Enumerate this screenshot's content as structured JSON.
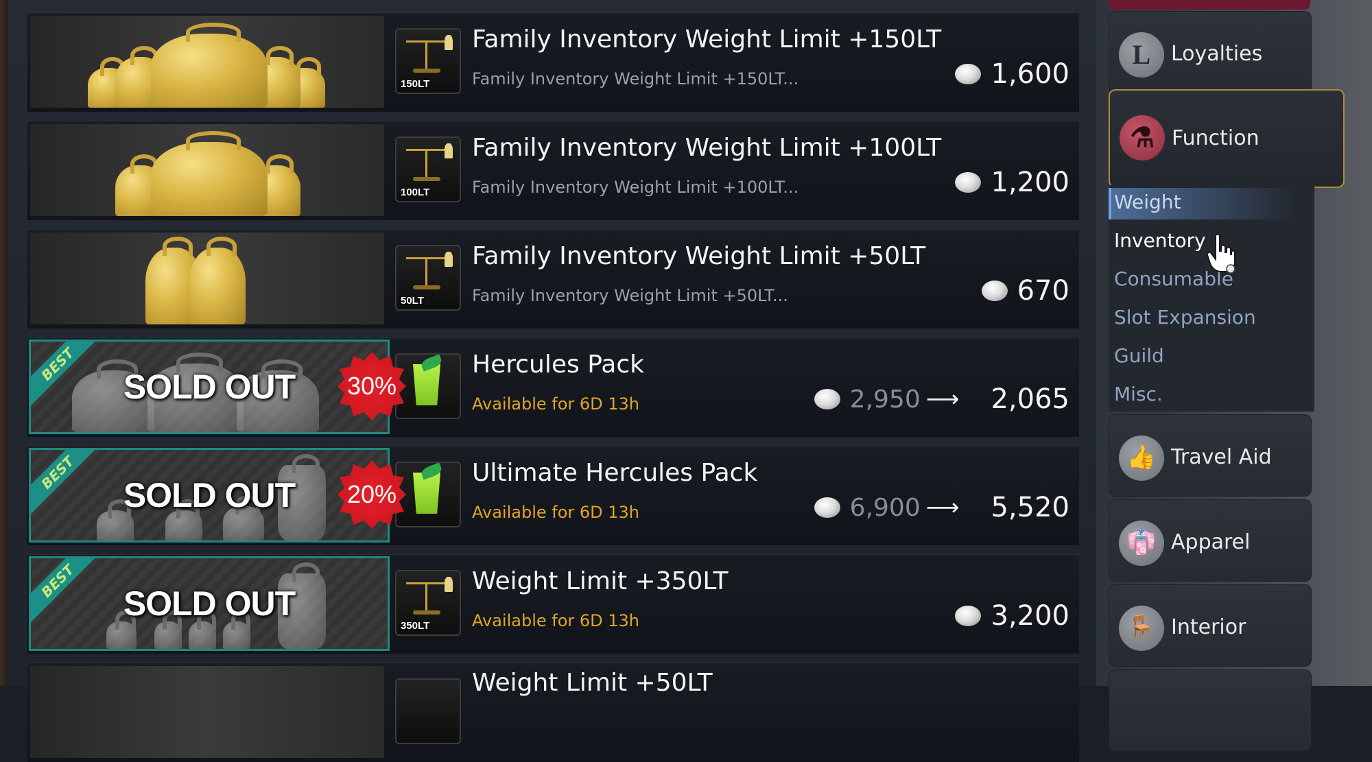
{
  "items": [
    {
      "title": "Family Inventory Weight Limit +150LT",
      "subtitle": "Family Inventory Weight Limit +150LT...",
      "icon_caption": "150LT",
      "price": "1,600"
    },
    {
      "title": "Family Inventory Weight Limit +100LT",
      "subtitle": "Family Inventory Weight Limit +100LT...",
      "icon_caption": "100LT",
      "price": "1,200"
    },
    {
      "title": "Family Inventory Weight Limit +50LT",
      "subtitle": "Family Inventory Weight Limit +50LT...",
      "icon_caption": "50LT",
      "price": "670"
    },
    {
      "title": "Hercules Pack",
      "subtitle": "Available for 6D 13h",
      "badge": "BEST",
      "status": "SOLD OUT",
      "discount": "30%",
      "old_price": "2,950",
      "price": "2,065"
    },
    {
      "title": "Ultimate Hercules Pack",
      "subtitle": "Available for 6D 13h",
      "badge": "BEST",
      "status": "SOLD OUT",
      "discount": "20%",
      "old_price": "6,900",
      "price": "5,520"
    },
    {
      "title": "Weight Limit +350LT",
      "subtitle": "Available for 6D 13h",
      "badge": "BEST",
      "status": "SOLD OUT",
      "icon_caption": "350LT",
      "price": "3,200"
    },
    {
      "title": "Weight Limit +50LT"
    }
  ],
  "sidebar": {
    "categories": [
      {
        "label": "Loyalties",
        "icon": "loyalty-l-icon",
        "glyph": "L"
      },
      {
        "label": "Function",
        "icon": "flask-icon",
        "glyph": "⚗"
      },
      {
        "label": "Travel Aid",
        "icon": "thumbs-up-icon",
        "glyph": "👍"
      },
      {
        "label": "Apparel",
        "icon": "jacket-icon",
        "glyph": "👘"
      },
      {
        "label": "Interior",
        "icon": "chair-icon",
        "glyph": "🪑"
      }
    ],
    "subcategories": [
      "Weight",
      "Inventory",
      "Consumable",
      "Slot Expansion",
      "Guild",
      "Misc."
    ],
    "selected_subcategory": "Weight",
    "hovered_subcategory": "Inventory"
  },
  "colors": {
    "accent_gold": "#b08a3b",
    "timer": "#e0a526",
    "discount_red": "#e4202a",
    "best_teal": "#1c8f86"
  }
}
